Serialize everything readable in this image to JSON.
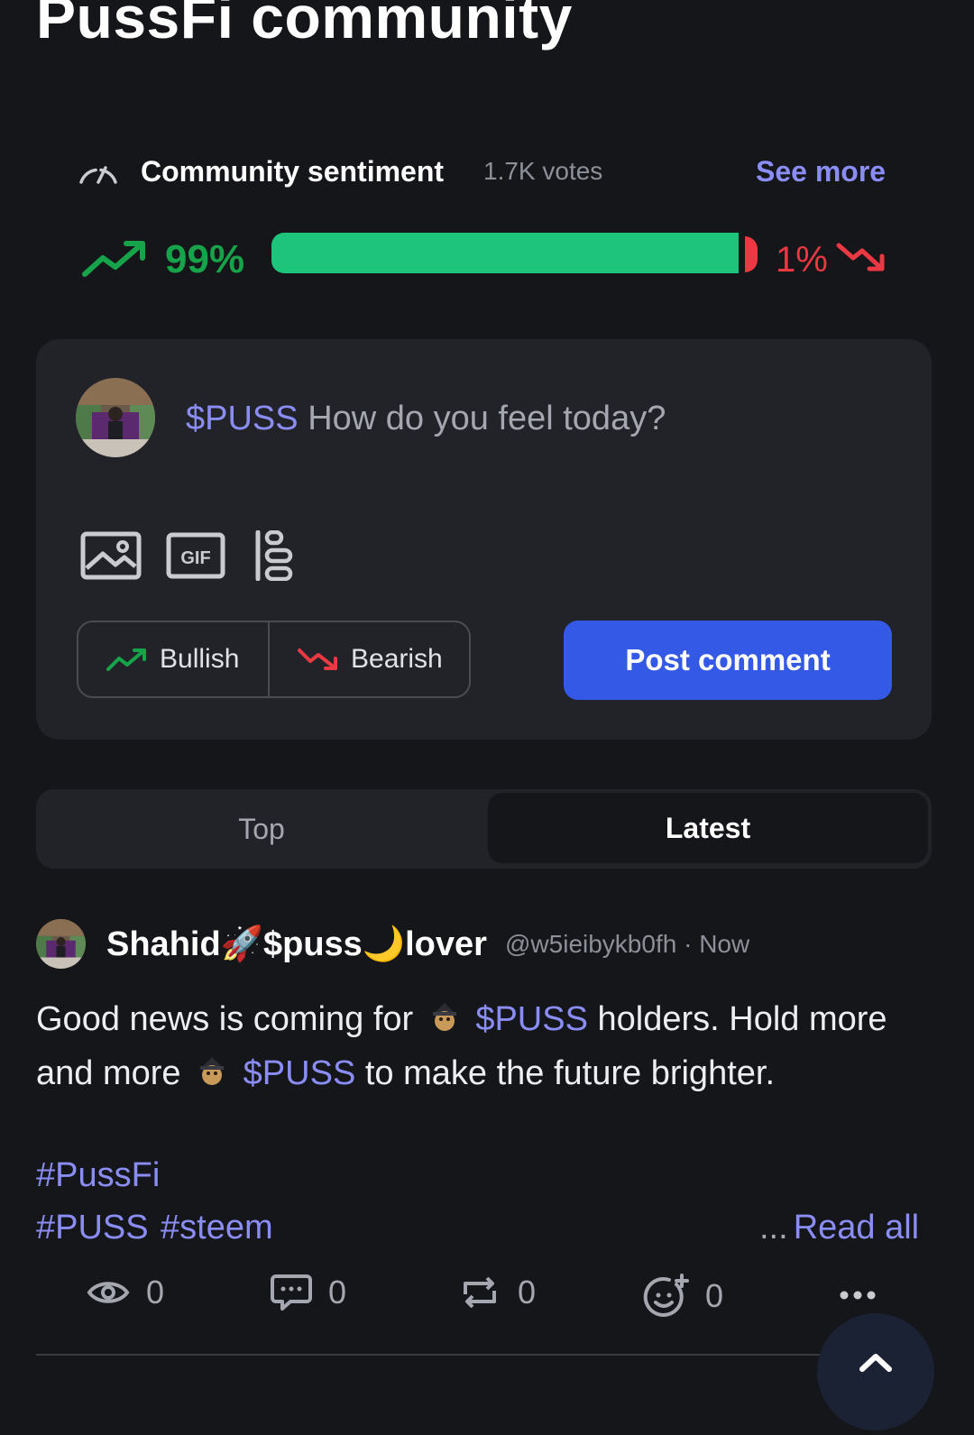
{
  "page": {
    "title": "PussFi community"
  },
  "sentiment": {
    "title": "Community sentiment",
    "votes": "1.7K votes",
    "see_more": "See more",
    "bullish_pct": "99%",
    "bearish_pct": "1%",
    "bullish_fraction": 0.99,
    "colors": {
      "bullish": "#1ec37c",
      "bearish": "#ea3943"
    },
    "icons": {
      "gauge": "gauge-icon",
      "up": "trend-up-icon",
      "down": "trend-down-icon"
    }
  },
  "composer": {
    "ticker": "$PUSS",
    "placeholder": "How do you feel today?",
    "tools": [
      "image-icon",
      "gif-icon",
      "poll-icon"
    ],
    "bullish_label": "Bullish",
    "bearish_label": "Bearish",
    "post_label": "Post comment",
    "accent": "#3459e6"
  },
  "tabs": [
    {
      "label": "Top",
      "active": false
    },
    {
      "label": "Latest",
      "active": true
    }
  ],
  "post": {
    "author": "Shahid🚀$puss🌙lover",
    "handle": "@w5ieibykb0fh",
    "time_sep": "·",
    "time": "Now",
    "body": {
      "part1": "Good news is coming for",
      "ticker1": "$PUSS",
      "part2": "holders. Hold more and more",
      "ticker2": "$PUSS",
      "part3": "to make the future brighter."
    },
    "tags": [
      "#PussFi",
      "#PUSS",
      "#steem"
    ],
    "ellipsis": "...",
    "read_all": "Read all",
    "stats": {
      "views": "0",
      "comments": "0",
      "reposts": "0",
      "reactions": "0"
    }
  }
}
